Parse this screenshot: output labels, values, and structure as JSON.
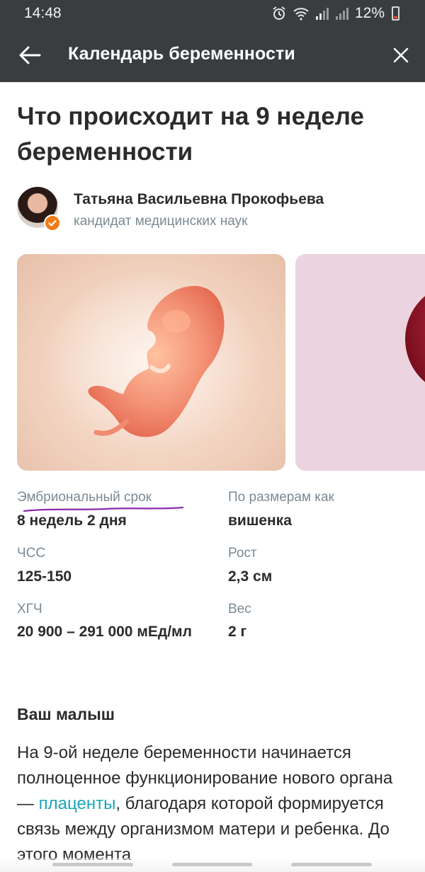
{
  "status_bar": {
    "time": "14:48",
    "battery": "12%"
  },
  "app_bar": {
    "title": "Календарь беременности",
    "icons": {
      "back": "arrow-left-icon",
      "close": "close-icon"
    }
  },
  "article": {
    "title": "Что происходит на 9 неделе беременности",
    "author": {
      "name": "Татьяна Васильевна Прокофьева",
      "role": "кандидат медицинских наук"
    },
    "facts": [
      {
        "label": "Эмбриональный срок",
        "value": "8 недель 2 дня"
      },
      {
        "label": "По размерам как",
        "value": "вишенка"
      },
      {
        "label": "ЧСС",
        "value": "125-150"
      },
      {
        "label": "Рост",
        "value": "2,3 см"
      },
      {
        "label": "ХГЧ",
        "value": "20 900 – 291 000 мЕд/мл"
      },
      {
        "label": "Вес",
        "value": "2 г"
      }
    ],
    "section_title": "Ваш малыш",
    "body": {
      "part1": "На 9-ой неделе беременности начинается полноценное функционирование нового органа — ",
      "link": "плаценты",
      "part2": ", благодаря которой формируется связь между организмом матери и ребенка. До этого момента"
    }
  },
  "colors": {
    "app_bar": "#3a3d40",
    "link": "#1aa5b8",
    "badge": "#f07c1a",
    "muted": "#7c8a93",
    "annotation": "#8a2bb0"
  }
}
